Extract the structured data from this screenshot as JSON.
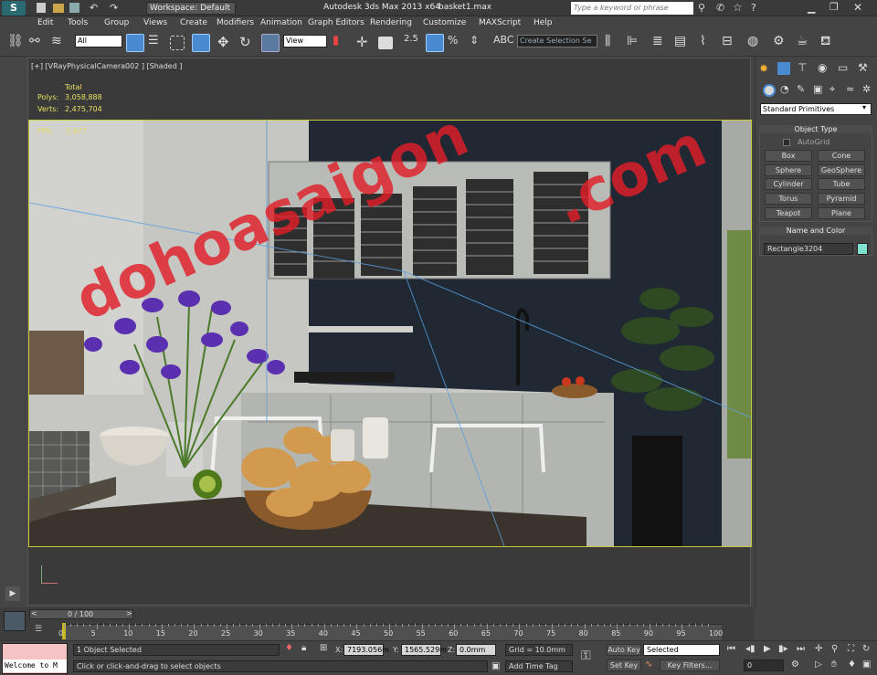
{
  "title_bar": {
    "workspace": "Workspace: Default",
    "app_title": "Autodesk 3ds Max  2013 x64",
    "file_name": "basket1.max",
    "search_placeholder": "Type a keyword or phrase"
  },
  "menu": [
    "Edit",
    "Tools",
    "Group",
    "Views",
    "Create",
    "Modifiers",
    "Animation",
    "Graph Editors",
    "Rendering",
    "Customize",
    "MAXScript",
    "Help"
  ],
  "toolbar": {
    "filter_value": "All",
    "ref_coord_value": "View",
    "selection_set_value": "Create Selection Se"
  },
  "viewport": {
    "label": "[+] [VRayPhysicalCamera002 ] [Shaded ]",
    "stats": {
      "header": "Total",
      "polys_label": "Polys:",
      "polys_value": "3,058,888",
      "verts_label": "Verts:",
      "verts_value": "2,475,704",
      "fps_label": "FPS:",
      "fps_value": "3.477"
    }
  },
  "watermark": {
    "part1": "dohoasaigon",
    "part2": ".com",
    "color": "#e11e28"
  },
  "command_panel": {
    "dropdown_value": "Standard Primitives",
    "object_type_title": "Object Type",
    "autogrid_label": "AutoGrid",
    "buttons": [
      "Box",
      "Cone",
      "Sphere",
      "GeoSphere",
      "Cylinder",
      "Tube",
      "Torus",
      "Pyramid",
      "Teapot",
      "Plane"
    ],
    "name_color_title": "Name and Color",
    "object_name": "Rectangle3204",
    "object_color": "#7fe0d0"
  },
  "timeline": {
    "frame_counter": "0 / 100",
    "ticks": [
      "0",
      "5",
      "10",
      "15",
      "20",
      "25",
      "30",
      "35",
      "40",
      "45",
      "50",
      "55",
      "60",
      "65",
      "70",
      "75",
      "80",
      "85",
      "90",
      "95",
      "100"
    ]
  },
  "status": {
    "script_label": "Welcome to M",
    "selection_text": "1 Object Selected",
    "prompt_text": "Click or click-and-drag to select objects",
    "x_label": "X:",
    "x_value": "7193.056m",
    "y_label": "Y:",
    "y_value": "1565.529m",
    "z_label": "Z:",
    "z_value": "0.0mm",
    "grid_text": "Grid = 10.0mm",
    "add_time_tag": "Add Time Tag",
    "auto_key": "Auto Key",
    "set_key": "Set Key",
    "key_mode_value": "Selected",
    "key_filters": "Key Filters...",
    "frame_value": "0"
  }
}
